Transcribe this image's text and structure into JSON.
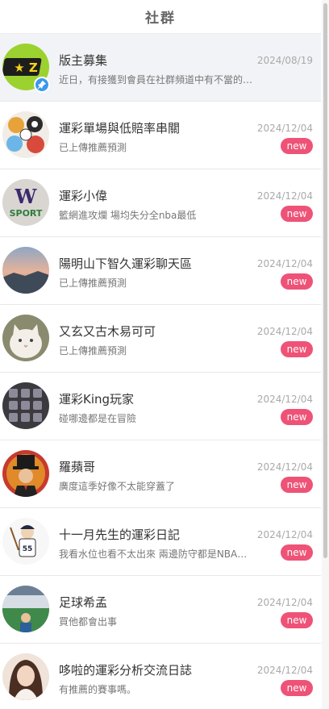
{
  "header": {
    "title": "社群"
  },
  "colors": {
    "new_badge": "#ee5377",
    "pin_badge": "#3a98f0",
    "pinned_bg": "#f2f3f6"
  },
  "items": [
    {
      "name": "版主募集",
      "subtitle": "近日，有接獲到會員在社群頻道中有不當的…",
      "date": "2024/08/19",
      "pinned": true,
      "avatar_icon": "brand-logo-avatar"
    },
    {
      "name": "運彩單場與低賠率串關",
      "subtitle": "已上傳推薦預測",
      "date": "2024/12/04",
      "badge": "new",
      "avatar_icon": "sports-balls-avatar"
    },
    {
      "name": "運彩小偉",
      "subtitle": "籃網進攻爛 場均失分全nba最低",
      "date": "2024/12/04",
      "badge": "new",
      "avatar_icon": "w-sport-logo-avatar"
    },
    {
      "name": "陽明山下智久運彩聊天區",
      "subtitle": "已上傳推薦預測",
      "date": "2024/12/04",
      "badge": "new",
      "avatar_icon": "landscape-avatar"
    },
    {
      "name": "又玄又古木易可可",
      "subtitle": "已上傳推薦預測",
      "date": "2024/12/04",
      "badge": "new",
      "avatar_icon": "cat-avatar"
    },
    {
      "name": "運彩King玩家",
      "subtitle": "碰哪邊都是在冒險",
      "date": "2024/12/04",
      "badge": "new",
      "avatar_icon": "cards-grid-avatar"
    },
    {
      "name": "羅蘋哥",
      "subtitle": "廣度這季好像不太能穿蓋了",
      "date": "2024/12/04",
      "badge": "new",
      "avatar_icon": "gentleman-avatar"
    },
    {
      "name": "十一月先生的運彩日記",
      "subtitle": "我看水位也看不太出來 兩邊防守都是NBA數…",
      "date": "2024/12/04",
      "badge": "new",
      "avatar_icon": "baseball-player-avatar"
    },
    {
      "name": "足球希孟",
      "subtitle": "買他都會出事",
      "date": "2024/12/04",
      "badge": "new",
      "avatar_icon": "stadium-avatar"
    },
    {
      "name": "哆啦的運彩分析交流日誌",
      "subtitle": "有推薦的賽事嗎。",
      "date": "2024/12/04",
      "badge": "new",
      "avatar_icon": "portrait-avatar"
    }
  ]
}
